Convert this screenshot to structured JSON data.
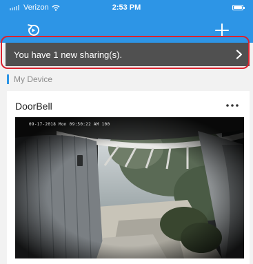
{
  "status_bar": {
    "carrier": "Verizon",
    "time": "2:53 PM",
    "icons": [
      "signal-icon",
      "wifi-icon",
      "battery-icon"
    ]
  },
  "nav": {
    "left_icon": "refresh-icon",
    "right_icon": "plus-icon"
  },
  "sharing_banner": {
    "text": "You have 1 new sharing(s).",
    "icon": "chevron-right-icon"
  },
  "section": {
    "title": "My Device"
  },
  "device": {
    "name": "DoorBell",
    "menu_icon": "more-icon",
    "camera_timestamp": "09-17-2018 Mon 09:50:22 AM 100"
  },
  "colors": {
    "nav_blue": "#2d95e6",
    "banner_gray": "#505050",
    "highlight_red": "#d9232f",
    "page_bg": "#f2f2f2"
  }
}
